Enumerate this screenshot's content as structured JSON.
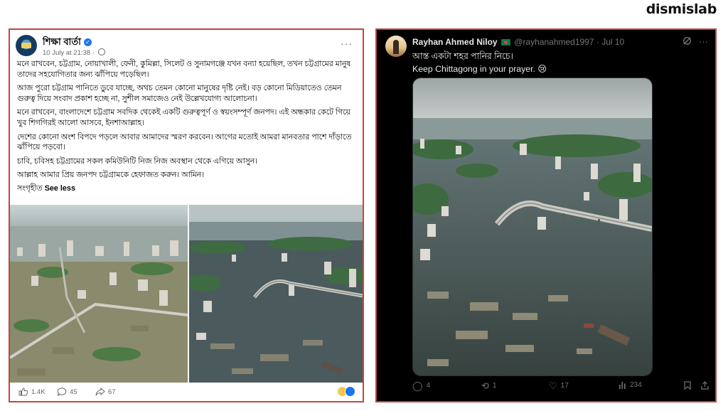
{
  "brand": "dismislab",
  "facebook_post": {
    "page_name": "শিক্ষা বার্তা",
    "timestamp": "10 July at 21:38 ·",
    "more": "···",
    "paragraphs": [
      "মনে রাখবেন, চট্টগ্রাম, নোয়াখালী, ফেনী, কুমিল্লা, সিলেট ও সুনামগঞ্জে যখন বন্যা হয়েছিল, তখন চট্টগ্রামের মানুষ তাদের সহযোগিতার জন্য ঝাঁপিয়ে পড়েছিল।",
      "আজ পুরো চট্টগ্রাম পানিতে ডুবে যাচ্ছে, অথচ তেমন কোনো মানুষের দৃষ্টি নেই। বড় কোনো মিডিয়াতেও তেমন গুরুত্ব দিয়ে সংবাদ প্রকাশ হচ্ছে না, সুশীল সমাজেও নেই উল্লেখযোগ্য আলোচনা।",
      "মনে রাখবেন, বাংলাদেশে চট্টগ্রাম সবদিক থেকেই একটি গুরুত্বপূর্ণ ও স্বয়ংসম্পূর্ণ জনপদ। এই অন্ধকার কেটে গিয়ে খুব শিগগিরই আলো আসবে, ইনশাআল্লাহ।",
      "দেশের কোনো অংশ বিপদে পড়লে আবার আমাদের স্মরণ করবেন। আগের মতোই আমরা মানবতার পাশে দাঁড়াতে ঝাঁপিয়ে পড়বো।",
      "চাবি, চবিসহ চট্টগ্রামের সকল কমিউনিটি নিজ নিজ অবস্থান থেকে এগিয়ে আসুন।",
      "আল্লাহ আমার প্রিয় জনপদ চট্টগ্রামকে হেফাজত করুন। আমিন।"
    ],
    "collected_label": "সংগৃহীত",
    "see_less": "See less",
    "likes": "1.4K",
    "comments": "45",
    "shares": "67"
  },
  "tweet": {
    "display_name": "Rayhan Ahmed Niloy",
    "handle": "@rayhanahmed1997",
    "date": "· Jul 10",
    "line1": "আস্ত একটা শহর পানির নিচে।",
    "line2": "Keep Chittagong in your prayer. 😢",
    "replies": "4",
    "reposts": "1",
    "likes": "17",
    "views": "234"
  },
  "colors": {
    "highlight_border": "#c0473f",
    "fb_blue": "#1877f2",
    "tweet_bg": "#000000",
    "flood_water": "#4b5a5c"
  }
}
